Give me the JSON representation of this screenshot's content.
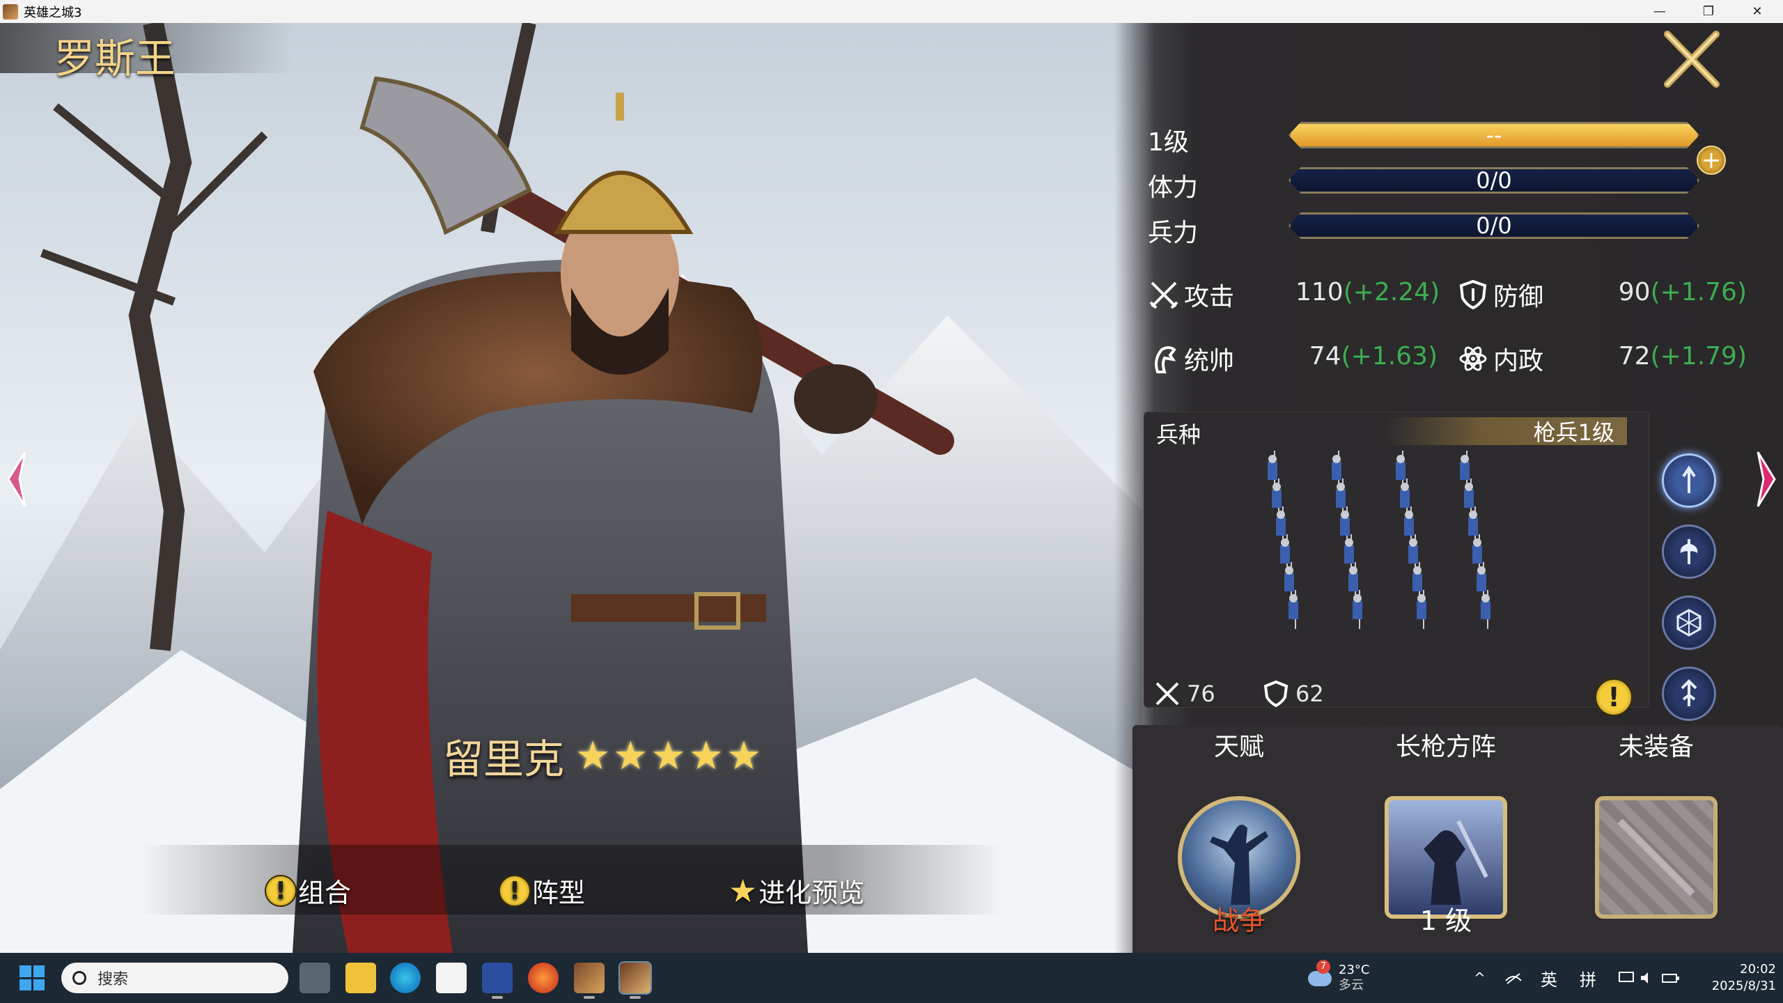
{
  "window": {
    "title": "英雄之城3",
    "controls": {
      "minimize": "—",
      "maximize": "❐",
      "close": "✕"
    }
  },
  "hero": {
    "region": "罗斯王",
    "name": "留里克",
    "stars": 5,
    "star_glyph": "★"
  },
  "bottom_buttons": {
    "combo": "组合",
    "formation": "阵型",
    "evolution": "进化预览",
    "warn_glyph": "!"
  },
  "stats": {
    "level_label": "1级",
    "level_bar_text": "--",
    "stamina_label": "体力",
    "stamina_value": "0/0",
    "troops_label": "兵力",
    "troops_value": "0/0",
    "plus": "+"
  },
  "attributes": {
    "attack": {
      "label": "攻击",
      "value": "110",
      "bonus": "(+2.24)"
    },
    "defense": {
      "label": "防御",
      "value": "90",
      "bonus": "(+1.76)"
    },
    "command": {
      "label": "统帅",
      "value": "74",
      "bonus": "(+1.63)"
    },
    "politics": {
      "label": "内政",
      "value": "72",
      "bonus": "(+1.79)"
    }
  },
  "troop": {
    "title": "兵种",
    "type": "枪兵1级",
    "attack": "76",
    "defense": "62",
    "warn": "!"
  },
  "skills": {
    "talent_label": "天赋",
    "talent_name": "战争",
    "formation_label": "长枪方阵",
    "formation_level": "1 级",
    "equip_label": "未装备"
  },
  "taskbar": {
    "search_placeholder": "搜索",
    "weather_temp": "23°C",
    "weather_desc": "多云",
    "weather_badge": "7",
    "ime_lang": "英",
    "ime_mode": "拼",
    "time": "20:02",
    "date": "2025/8/31"
  },
  "colors": {
    "gold": "#f4d48a",
    "bonus_green": "#3cae51",
    "talent_red": "#e8572f",
    "panel": "#2c2a2c"
  }
}
